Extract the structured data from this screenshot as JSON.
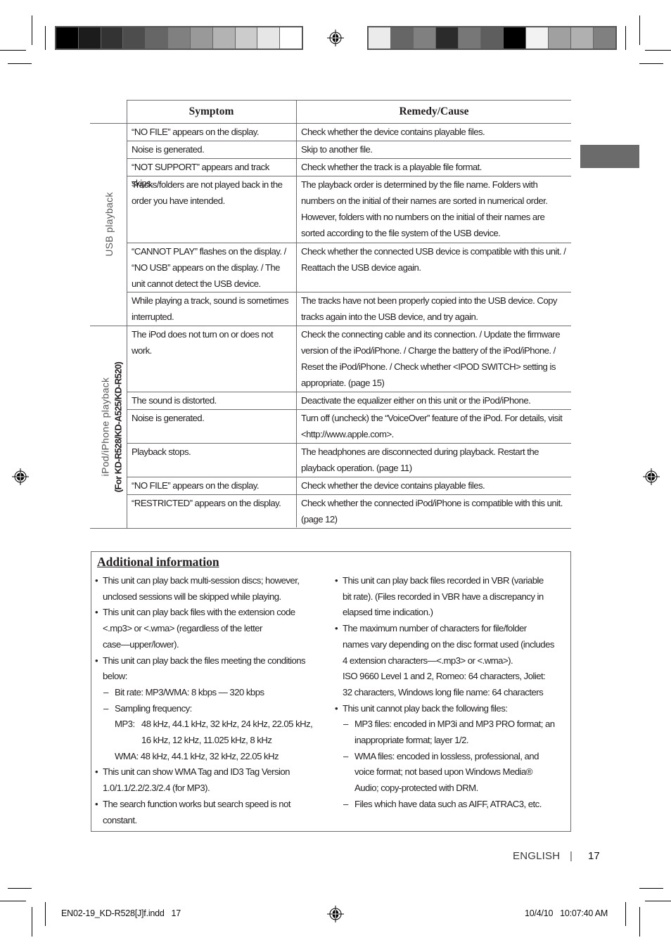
{
  "table": {
    "headers": {
      "symptom": "Symptom",
      "remedy": "Remedy/Cause"
    },
    "groups": [
      {
        "label": "USB playback",
        "sublabel": "",
        "rows": [
          {
            "symptom": "“NO FILE” appears on the display.",
            "remedy": "Check whether the device contains playable files."
          },
          {
            "symptom": "Noise is generated.",
            "remedy": "Skip to another file."
          },
          {
            "symptom": "“NOT SUPPORT” appears and track skips.",
            "remedy": "Check whether the track is a playable file format."
          },
          {
            "symptom": "Tracks/folders are not played back in the order you have intended.",
            "remedy": "The playback order is determined by the file name. Folders with numbers on the initial of their names are sorted in numerical order. However, folders with no numbers on the initial of their names are sorted according to the file system of the USB device."
          },
          {
            "symptom": "“CANNOT PLAY” flashes on the display. / “NO USB” appears on the display. / The unit cannot detect the USB device.",
            "remedy": "Check whether the connected USB device is compatible with this unit. / Reattach the USB device again."
          },
          {
            "symptom": "While playing a track, sound is sometimes interrupted.",
            "remedy": "The tracks have not been properly copied into the USB device. Copy tracks again into the USB device, and try again."
          }
        ]
      },
      {
        "label": "iPod/iPhone playback",
        "sublabel": "(For KD-R528/KD-A525/KD-R520)",
        "rows": [
          {
            "symptom": "The iPod does not turn on or does not work.",
            "remedy": "Check the connecting cable and its connection. / Update the firmware version of the iPod/iPhone. / Charge the battery of the iPod/iPhone. / Reset the iPod/iPhone. / Check whether <IPOD SWITCH> setting is appropriate. (page 15)"
          },
          {
            "symptom": "The sound is distorted.",
            "remedy": "Deactivate the equalizer either on this unit or the iPod/iPhone."
          },
          {
            "symptom": "Noise is generated.",
            "remedy": "Turn off (uncheck) the “VoiceOver” feature of the iPod. For details, visit <http://www.apple.com>."
          },
          {
            "symptom": "Playback stops.",
            "remedy": "The headphones are disconnected during playback. Restart the playback operation. (page 11)"
          },
          {
            "symptom": "“NO FILE” appears on the display.",
            "remedy": "Check whether the device contains playable files."
          },
          {
            "symptom": "“RESTRICTED” appears on the display.",
            "remedy": "Check whether the connected iPod/iPhone is compatible with this unit. (page 12)"
          }
        ]
      }
    ]
  },
  "info": {
    "title": "Additional information",
    "left": {
      "b1a": "This unit can play back multi-session discs; however,",
      "b1b": "unclosed sessions will be skipped while playing.",
      "b2a": "This unit can play back files with the extension code",
      "b2b": "<.mp3> or <.wma> (regardless of the letter",
      "b2c": "case—upper/lower).",
      "b3a": "This unit can play back the files meeting the conditions",
      "b3b": "below:",
      "s1": "Bit rate: MP3/WMA: 8 kbps — 320 kbps",
      "s2": "Sampling frequency:",
      "mp3a": "MP3:   48 kHz, 44.1 kHz, 32 kHz, 24 kHz, 22.05 kHz,",
      "mp3b": "16 kHz, 12 kHz, 11.025 kHz, 8 kHz",
      "wma": "WMA: 48 kHz, 44.1 kHz, 32 kHz, 22.05 kHz",
      "b4a": "This unit can show WMA Tag and ID3 Tag Version",
      "b4b": "1.0/1.1/2.2/2.3/2.4 (for MP3).",
      "b5a": "The search function works but search speed is not",
      "b5b": "constant."
    },
    "right": {
      "b1a": "This unit can play back files recorded in VBR (variable",
      "b1b": "bit rate). (Files recorded in VBR have a discrepancy in",
      "b1c": "elapsed time indication.)",
      "b2a": "The maximum number of characters for file/folder",
      "b2b": "names vary depending on the disc format used (includes",
      "b2c": "4 extension characters—<.mp3> or <.wma>).",
      "b2d": "ISO 9660 Level 1 and 2, Romeo: 64 characters, Joliet:",
      "b2e": "32 characters, Windows long file name: 64 characters",
      "b3": "This unit cannot play back the following files:",
      "s1a": "MP3 files: encoded in MP3i and MP3 PRO format; an",
      "s1b": "inappropriate format; layer 1/2.",
      "s2a": "WMA files: encoded in lossless, professional, and",
      "s2b": "voice format; not based upon Windows Media®",
      "s2c": "Audio; copy-protected with DRM.",
      "s3": "Files which have data such as AIFF, ATRAC3, etc."
    }
  },
  "footer": {
    "language": "ENGLISH",
    "separator": "|",
    "page": "17"
  },
  "slug": {
    "file": "EN02-19_KD-R528[J]f.indd   17",
    "datetime": "10/4/10   10:07:40 AM"
  },
  "colorbars": {
    "left": [
      "#000000",
      "#1c1c1c",
      "#333333",
      "#4d4d4d",
      "#666666",
      "#808080",
      "#999999",
      "#b3b3b3",
      "#cccccc",
      "#e6e6e6",
      "#ffffff"
    ],
    "right": [
      "#ebebeb",
      "#666666",
      "#808080",
      "#2b2b2b",
      "#777777",
      "#5e5e5e",
      "#000000",
      "#f2f2f2",
      "#a0a0a0",
      "#b0b0b0",
      "#808080"
    ]
  },
  "tab_marker_color": "#6b6b6b"
}
